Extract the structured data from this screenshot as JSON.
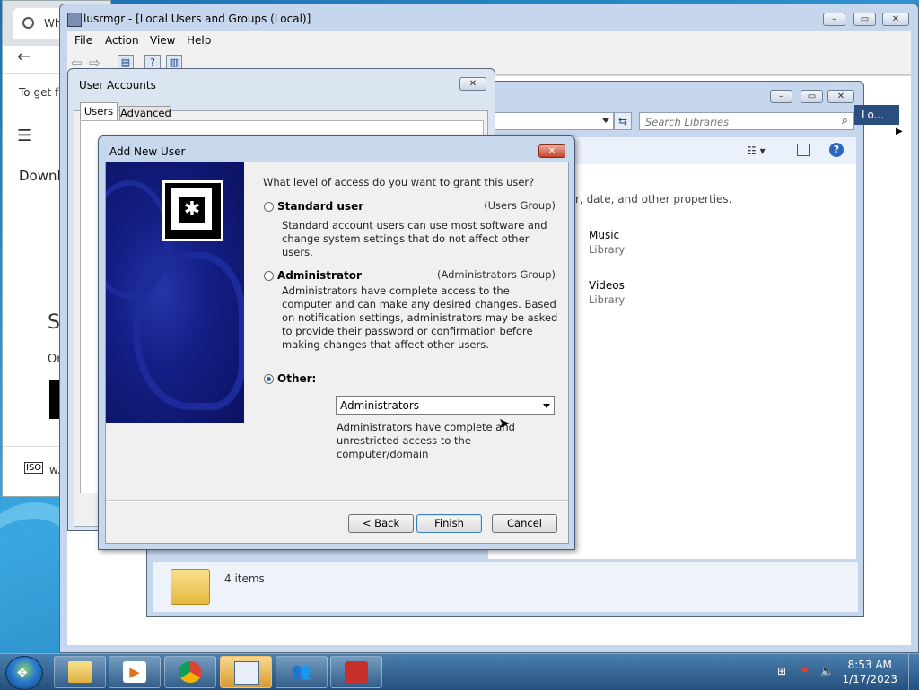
{
  "browser": {
    "tab_text": "Wh",
    "line1": "To get f",
    "line2": "Downl",
    "big_s": "S",
    "or_text": "Or",
    "bottom_text": "w."
  },
  "lusrmgr": {
    "title": "lusrmgr - [Local Users and Groups (Local)]",
    "menu": [
      "File",
      "Action",
      "View",
      "Help"
    ]
  },
  "user_accounts": {
    "title": "User Accounts",
    "tabs": [
      "Users",
      "Advanced"
    ]
  },
  "libraries": {
    "search_placeholder": "Search Libraries",
    "top_right": "Lo...",
    "info_text": "der, date, and other properties.",
    "items": [
      {
        "name": "Music",
        "type": "Library"
      },
      {
        "name": "Videos",
        "type": "Library"
      }
    ],
    "status": "4 items"
  },
  "dialog": {
    "title": "Add New User",
    "question": "What level of access do you want to grant this user?",
    "options": {
      "standard": {
        "label": "Standard user",
        "group": "(Users Group)",
        "desc": "Standard account users can use most software and change system settings that do not affect other users."
      },
      "admin": {
        "label": "Administrator",
        "group": "(Administrators Group)",
        "desc": "Administrators have complete access to the computer and can make any desired changes. Based on notification settings, administrators may be asked to provide their password or confirmation before making changes that affect other users."
      },
      "other": {
        "label": "Other:",
        "selected_value": "Administrators",
        "desc": "Administrators have complete and unrestricted access to the computer/domain"
      }
    },
    "selected_option": "other",
    "buttons": {
      "back": "< Back",
      "finish": "Finish",
      "cancel": "Cancel"
    }
  },
  "taskbar": {
    "time": "8:53 AM",
    "date": "1/17/2023"
  },
  "colors": {
    "banner": "#141f86",
    "taskbar": "#25507e",
    "close_red": "#c6452e"
  }
}
